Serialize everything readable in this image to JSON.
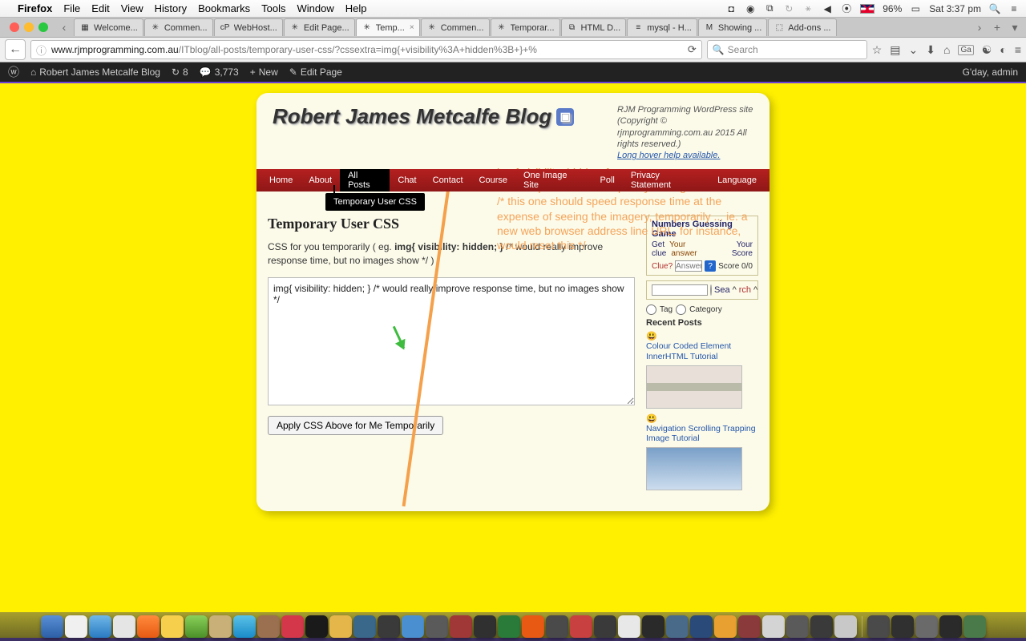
{
  "mac_menu": {
    "app": "Firefox",
    "items": [
      "File",
      "Edit",
      "View",
      "History",
      "Bookmarks",
      "Tools",
      "Window",
      "Help"
    ],
    "battery": "96%",
    "clock": "Sat 3:37 pm"
  },
  "firefox": {
    "tabs": [
      {
        "label": "Welcome...",
        "icon": "▦"
      },
      {
        "label": "Commen...",
        "icon": "✳"
      },
      {
        "label": "WebHost...",
        "icon": "cP"
      },
      {
        "label": "Edit Page...",
        "icon": "✳"
      },
      {
        "label": "Temp...",
        "icon": "✳",
        "active": true
      },
      {
        "label": "Commen...",
        "icon": "✳"
      },
      {
        "label": "Temporar...",
        "icon": "✳"
      },
      {
        "label": "HTML D...",
        "icon": "⧉"
      },
      {
        "label": "mysql - H...",
        "icon": "≡"
      },
      {
        "label": "Showing ...",
        "icon": "M"
      },
      {
        "label": "Add-ons ...",
        "icon": "⬚"
      }
    ],
    "url_host": "www.rjmprogramming.com.au",
    "url_path": "/ITblog/all-posts/temporary-user-css/?cssextra=img{+visibility%3A+hidden%3B+}+%",
    "search_placeholder": "Search",
    "ga_label": "Ga"
  },
  "wp": {
    "site": "Robert James Metcalfe Blog",
    "updates": "8",
    "comments": "3,773",
    "new": "New",
    "edit": "Edit Page",
    "greeting": "G'day, admin"
  },
  "page": {
    "title": "Robert James Metcalfe Blog",
    "tagline": "RJM Programming WordPress site (Copyright © rjmprogramming.com.au 2015 All rights reserved.)",
    "hover_link": "Long hover help available.",
    "annotation_css": "img{ visibility; hidden; }",
    "annotation_c1": "/* user specific CSS temporary setting */",
    "annotation_c2": "/* this one should speed response time at the expense of seeing the imagery, temporarily ... ie. a new web browser address line URL, for instance, would reset this  */",
    "nav": [
      "Home",
      "About",
      "All Posts",
      "Chat",
      "Contact",
      "Course",
      "One Image Site",
      "Poll",
      "Privacy Statement",
      "Language"
    ],
    "nav_active": 2,
    "nav_tooltip": "Temporary User CSS",
    "heading": "Temporary User CSS",
    "intro_pre": "CSS for you temporarily ( eg. ",
    "intro_code": "img{ visibility: hidden; }",
    "intro_post": " /* would really improve response time, but no images show */ )",
    "textarea_value": "img{ visibility: hidden; } /* would really improve response time, but no images show */",
    "apply_button": "Apply CSS Above for Me Temporarily"
  },
  "sidebar": {
    "guess_title": "Numbers Guessing Game",
    "guess_h": [
      "Get",
      "Your",
      "Your"
    ],
    "guess_r": [
      "clue",
      "answer",
      "Score"
    ],
    "clue_label": "Clue?",
    "answer_ph": "Answer?",
    "score": "Score 0/0",
    "search_sea": "Sea",
    "search_rch": "rch",
    "radio_tag": "Tag",
    "radio_cat": "Category",
    "recent_title": "Recent Posts",
    "post1": "Colour Coded Element InnerHTML Tutorial",
    "post2": "Navigation Scrolling Trapping Image Tutorial"
  }
}
